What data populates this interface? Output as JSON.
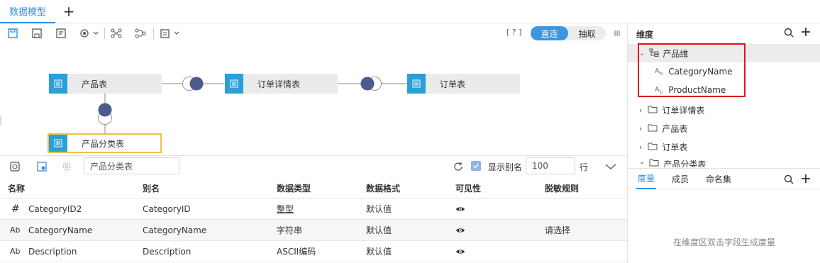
{
  "tabs": {
    "active_label": "数据模型",
    "add_label": "+"
  },
  "toolbar": {
    "help_label": "[ ? ]",
    "direct_label": "直连",
    "extract_label": "抽取"
  },
  "model": {
    "nodes": {
      "product": "产品表",
      "order_detail": "订单详情表",
      "order": "订单表",
      "category": "产品分类表"
    }
  },
  "lower": {
    "search_value": "产品分类表",
    "show_alias_label": "显示别名",
    "show_alias_checked": true,
    "row_count_value": "100",
    "row_unit_label": "行",
    "columns": [
      "名称",
      "别名",
      "数据类型",
      "数据格式",
      "可见性",
      "脱敏规则"
    ],
    "rows": [
      {
        "type_icon": "#",
        "name": "CategoryID2",
        "alias": "CategoryID",
        "dtype": "整型",
        "format": "默认值",
        "visible": "eye-icon",
        "mask": ""
      },
      {
        "type_icon": "Ab",
        "name": "CategoryName",
        "alias": "CategoryName",
        "dtype": "字符串",
        "format": "默认值",
        "visible": "eye-icon",
        "mask": "请选择"
      },
      {
        "type_icon": "Ab",
        "name": "Description",
        "alias": "Description",
        "dtype": "ASCII编码",
        "format": "默认值",
        "visible": "eye-icon",
        "mask": ""
      }
    ]
  },
  "dimension": {
    "title": "维度",
    "tree": [
      {
        "label": "产品维",
        "kind": "hierarchy",
        "expanded": true
      },
      {
        "label": "CategoryName",
        "kind": "field"
      },
      {
        "label": "ProductName",
        "kind": "field"
      },
      {
        "label": "订单详情表",
        "kind": "folder"
      },
      {
        "label": "产品表",
        "kind": "folder"
      },
      {
        "label": "订单表",
        "kind": "folder"
      },
      {
        "label": "产品分类表",
        "kind": "folder"
      }
    ]
  },
  "measure": {
    "tabs": [
      "度量",
      "成员",
      "命名集"
    ],
    "active_tab": "度量",
    "empty_hint": "在维度区双击字段生成度量"
  },
  "colors": {
    "accent": "#2f8fe6",
    "node_icon": "#2a9fd8",
    "join_dot": "#4b5b8c",
    "highlight_red": "#e0141e",
    "selected_yellow": "#f0c040"
  }
}
